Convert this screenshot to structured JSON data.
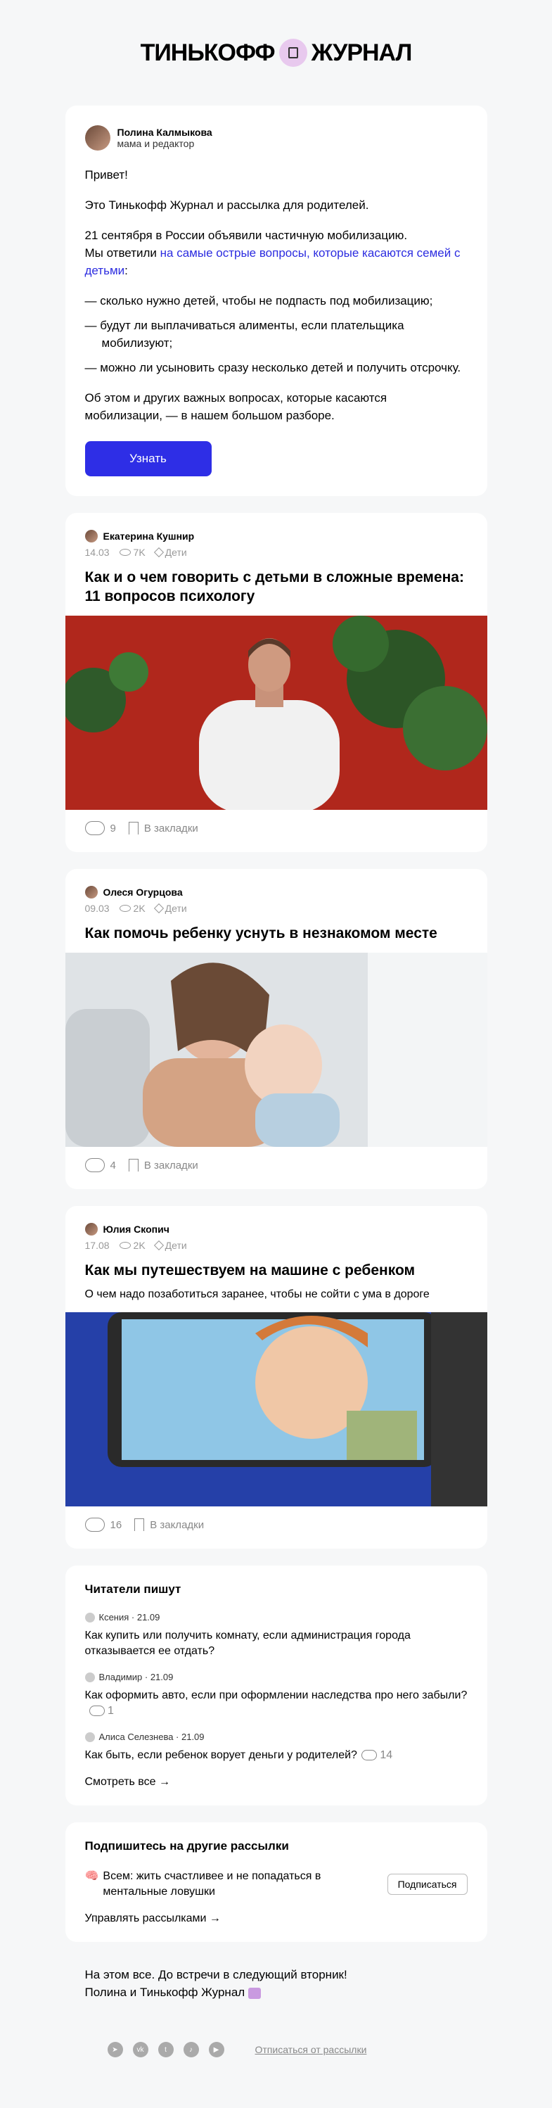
{
  "logo": {
    "left": "ТИНЬКОФФ",
    "right": "ЖУРНАЛ"
  },
  "intro": {
    "author_name": "Полина Калмыкова",
    "author_role": "мама и редактор",
    "p1": "Привет!",
    "p2": "Это Тинькофф Журнал и рассылка для родителей.",
    "p3a": "21 сентября в России объявили частичную мобилизацию.",
    "p3b": "Мы ответили",
    "p3link": "на самые острые вопросы, которые касаются семей с детьми",
    "p3c": ":",
    "bullets": [
      "— сколько нужно детей, чтобы не подпасть под мобилизацию;",
      "— будут ли выплачиваться алименты, если плательщика мобилизуют;",
      "— можно ли усыновить сразу несколько детей и получить отсрочку."
    ],
    "p4": "Об этом и других важных вопросах, которые касаются мобилизации, — в нашем большом разборе.",
    "button": "Узнать"
  },
  "articles": [
    {
      "author": "Екатерина Кушнир",
      "date": "14.03",
      "views": "7K",
      "tag": "Дети",
      "title": "Как и о чем говорить с детьми в сложные времена: 11 вопросов психологу",
      "subtitle": "",
      "comments": "9",
      "bookmark": "В закладки"
    },
    {
      "author": "Олеся Огурцова",
      "date": "09.03",
      "views": "2K",
      "tag": "Дети",
      "title": "Как помочь ребенку уснуть в незнакомом месте",
      "subtitle": "",
      "comments": "4",
      "bookmark": "В закладки"
    },
    {
      "author": "Юлия Скопич",
      "date": "17.08",
      "views": "2K",
      "tag": "Дети",
      "title": "Как мы путешествуем на машине с ребенком",
      "subtitle": "О чем надо позаботиться заранее, чтобы не сойти с ума в дороге",
      "comments": "16",
      "bookmark": "В закладки"
    }
  ],
  "readers": {
    "title": "Читатели пишут",
    "items": [
      {
        "meta": "Ксения · 21.09",
        "text": "Как купить или получить комнату, если администрация города отказывается ее отдать?",
        "count": ""
      },
      {
        "meta": "Владимир · 21.09",
        "text": "Как оформить авто, если при оформлении наследства про него забыли?",
        "count": "1"
      },
      {
        "meta": "Алиса Селезнева · 21.09",
        "text": "Как быть, если ребенок ворует деньги у родителей?",
        "count": "14"
      }
    ],
    "see_all": "Смотреть все →"
  },
  "subscribe": {
    "title": "Подпишитесь на другие рассылки",
    "item": "Всем: жить счастливее и не попадаться в ментальные ловушки",
    "button": "Подписаться",
    "manage": "Управлять рассылками →"
  },
  "bye": {
    "line1": "На этом все. До встречи в следующий вторник!",
    "line2": "Полина и Тинькофф Журнал"
  },
  "footer": {
    "socials": [
      "telegram-icon",
      "vk-icon",
      "twitter-icon",
      "tiktok-icon",
      "youtube-icon"
    ],
    "unsubscribe": "Отписаться от рассылки"
  }
}
